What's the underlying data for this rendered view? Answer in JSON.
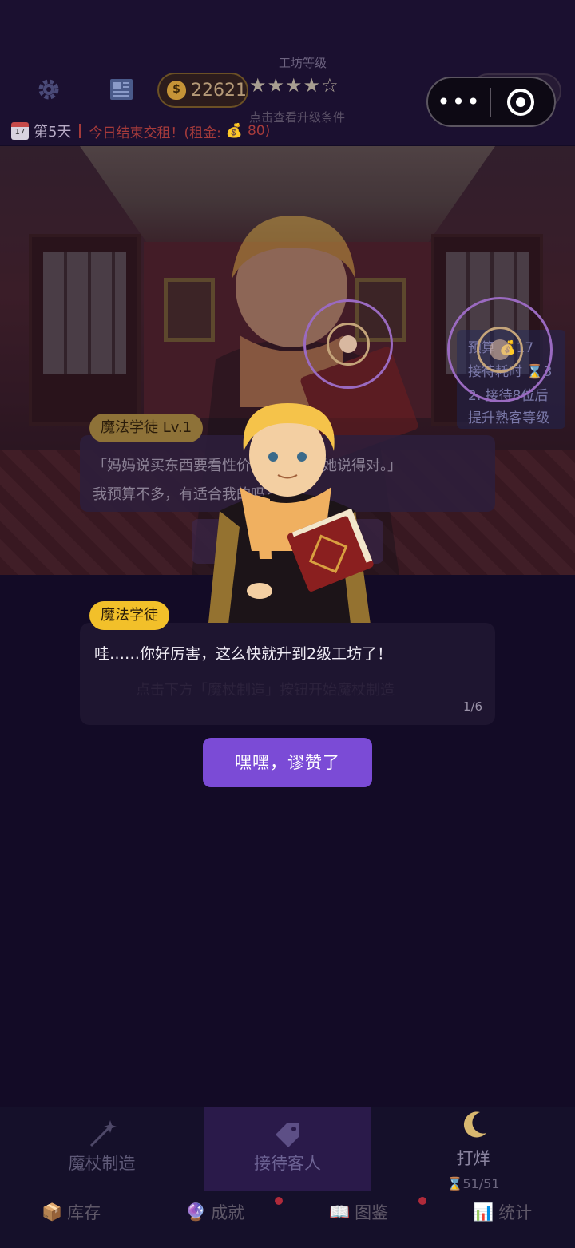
{
  "header": {
    "coins": "22621",
    "level_title": "工坊等级",
    "stars": "★★★★☆",
    "level_hint": "点击查看升级条件",
    "ghost_pill_value": "0"
  },
  "status": {
    "day": "第5天",
    "warning": "今日结束交租！(租金: ",
    "rent_amount": "80)"
  },
  "scene": {
    "side_card": [
      "预算 💰17",
      "接待耗时 ⌛3",
      "2. 接待8位后",
      "提升熟客等级"
    ],
    "ghost_tag": "魔法学徒 Lv.1",
    "ghost_line1": "「妈妈说买东西要看性价比，我觉得她说得对。」",
    "ghost_line2": "我预算不多，有适合我的吗？"
  },
  "dialog": {
    "speaker": "魔法学徒",
    "text": "哇……你好厉害，这么快就升到2级工坊了！",
    "faint_text": "点击下方「魔杖制造」按钮开始魔杖制造",
    "page": "1/6",
    "button": "嘿嘿，谬赞了"
  },
  "nav": {
    "main": [
      {
        "label": "魔杖制造",
        "icon": "magic-wand-icon"
      },
      {
        "label": "接待客人",
        "icon": "tag-icon"
      },
      {
        "label": "打烊",
        "icon": "moon-icon",
        "sub": "⌛51/51"
      }
    ],
    "sub": [
      {
        "label": "库存",
        "icon": "package-icon",
        "glyph": "📦"
      },
      {
        "label": "成就",
        "icon": "crystal-ball-icon",
        "glyph": "🔮"
      },
      {
        "label": "图鉴",
        "icon": "book-icon",
        "glyph": "📖"
      },
      {
        "label": "统计",
        "icon": "chart-icon",
        "glyph": "📊"
      }
    ]
  },
  "colors": {
    "background": "#130b26",
    "accent_purple": "#7b4bd6",
    "speaker_yellow": "#f2c02a",
    "warning_red": "#a63b3b",
    "active_tab": "#2a1a4a"
  }
}
